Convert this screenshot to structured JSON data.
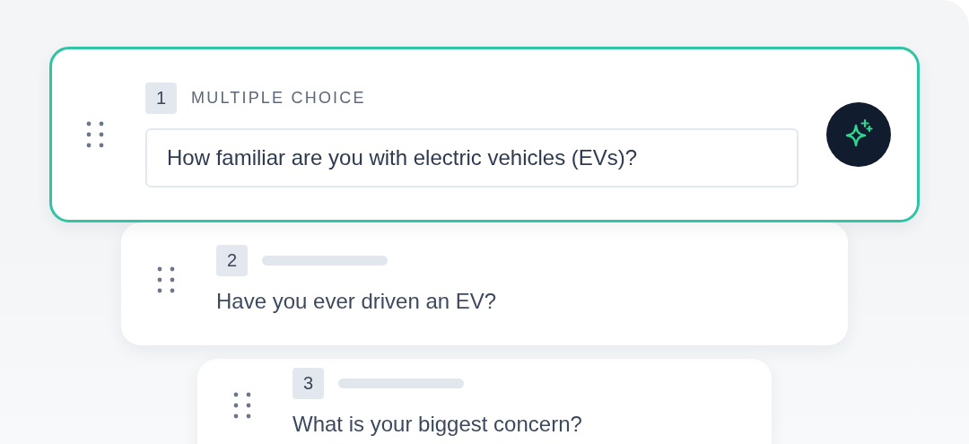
{
  "questions": [
    {
      "number": "1",
      "type": "MULTIPLE CHOICE",
      "text": "How familiar are you with electric vehicles (EVs)?",
      "selected": true
    },
    {
      "number": "2",
      "text": "Have you ever driven an EV?",
      "selected": false
    },
    {
      "number": "3",
      "text": "What is your biggest concern?",
      "selected": false
    }
  ]
}
